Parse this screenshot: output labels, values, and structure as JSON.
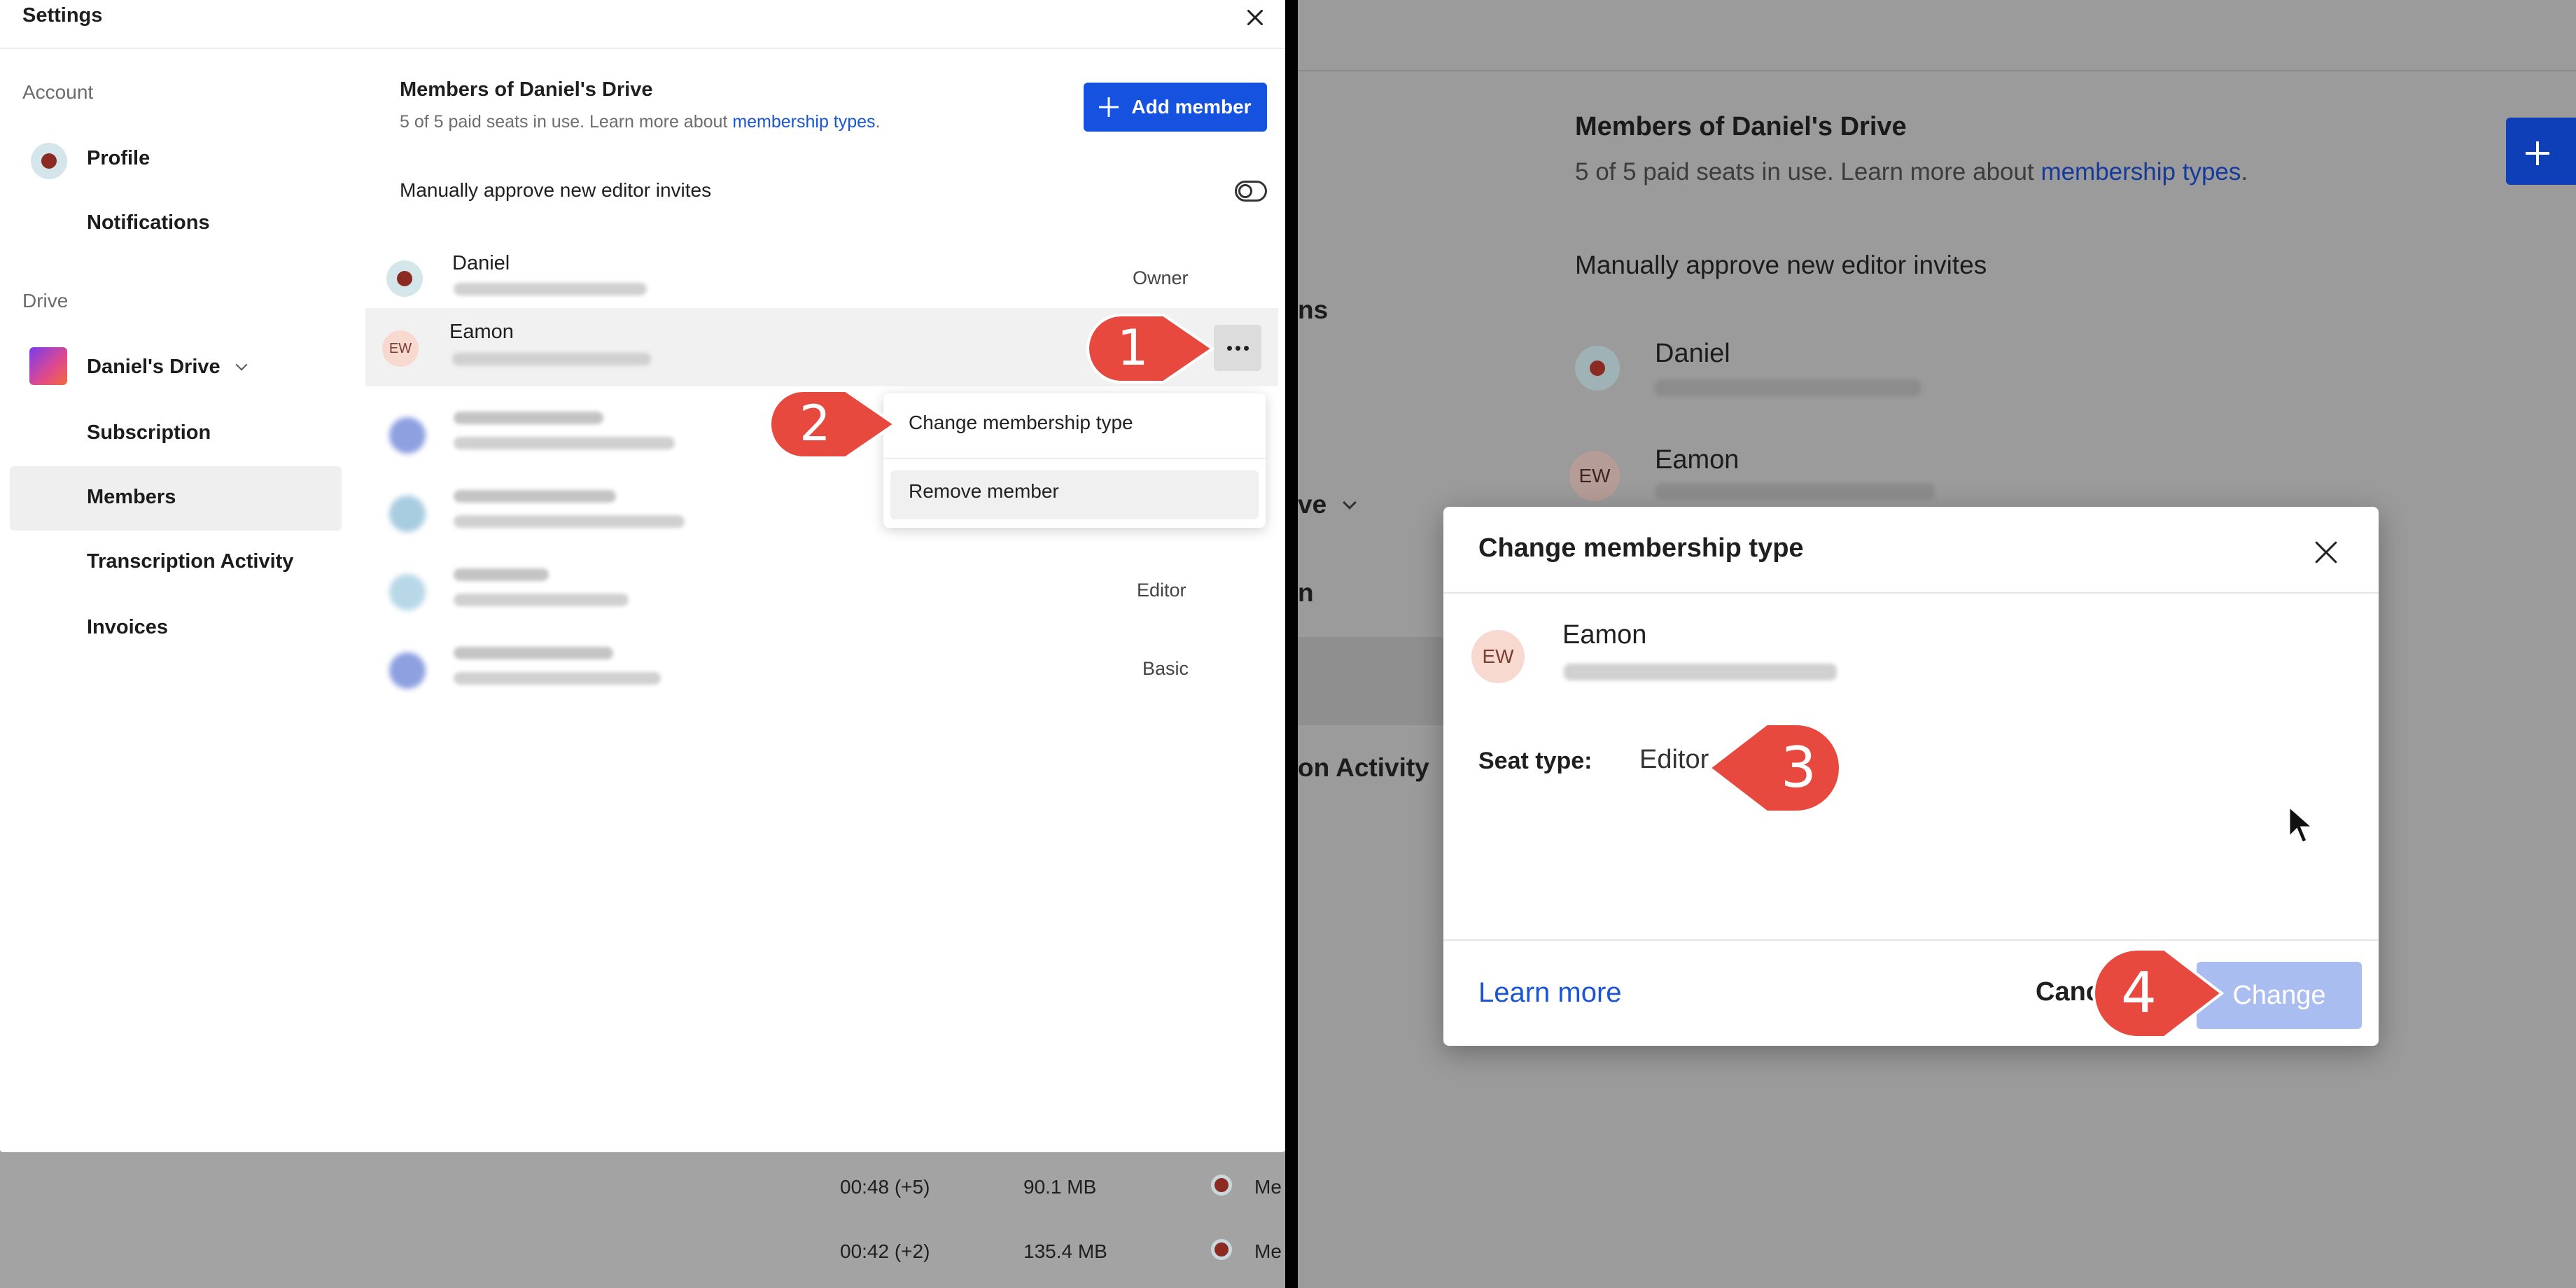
{
  "settings": {
    "title": "Settings",
    "sidebar": {
      "account_heading": "Account",
      "profile": "Profile",
      "notifications": "Notifications",
      "drive_heading": "Drive",
      "drive_name": "Daniel's Drive",
      "subscription": "Subscription",
      "members": "Members",
      "transcription_activity": "Transcription Activity",
      "invoices": "Invoices"
    },
    "members": {
      "heading": "Members of Daniel's Drive",
      "subtitle_prefix": "5 of 5 paid seats in use. Learn more about ",
      "subtitle_link": "membership types",
      "subtitle_suffix": ".",
      "add_button": "Add member",
      "approve_label": "Manually approve new editor invites",
      "rows": [
        {
          "name": "Daniel",
          "role": "Owner",
          "avatar": "red-dot"
        },
        {
          "name": "Eamon",
          "role": "",
          "avatar": "EW"
        },
        {
          "name": "",
          "role": "",
          "avatar": "blurred"
        },
        {
          "name": "",
          "role": "",
          "avatar": "blurred"
        },
        {
          "name": "",
          "role": "Editor",
          "avatar": "blurred"
        },
        {
          "name": "",
          "role": "Basic",
          "avatar": "blurred"
        }
      ]
    },
    "context_menu": {
      "change": "Change membership type",
      "remove": "Remove member"
    }
  },
  "background_rows": [
    {
      "duration": "00:48 (+5)",
      "size": "90.1 MB",
      "owner": "Me"
    },
    {
      "duration": "00:42 (+2)",
      "size": "135.4 MB",
      "owner": "Me"
    }
  ],
  "right_background": {
    "heading": "Members of Daniel's Drive",
    "subtitle_prefix": "5 of 5 paid seats in use. Learn more about ",
    "subtitle_link": "membership types",
    "subtitle_suffix": ".",
    "approve_label": "Manually approve new editor invites",
    "row1_name": "Daniel",
    "row2_name": "Eamon",
    "row2_avatar": "EW",
    "side_frag1": "ns",
    "side_frag2": "ve",
    "side_frag3": "n",
    "side_frag4": "on Activity"
  },
  "dialog": {
    "title": "Change membership type",
    "avatar": "EW",
    "member_name": "Eamon",
    "seat_label": "Seat type:",
    "seat_value": "Editor",
    "learn_more": "Learn more",
    "cancel": "Cancel",
    "change": "Change"
  },
  "callouts": {
    "c1": "1",
    "c2": "2",
    "c3": "3",
    "c4": "4",
    "color": "#e8493f"
  },
  "colors": {
    "accent": "#1652e0",
    "link": "#1a55d6",
    "change_disabled": "#a9bdf0"
  }
}
